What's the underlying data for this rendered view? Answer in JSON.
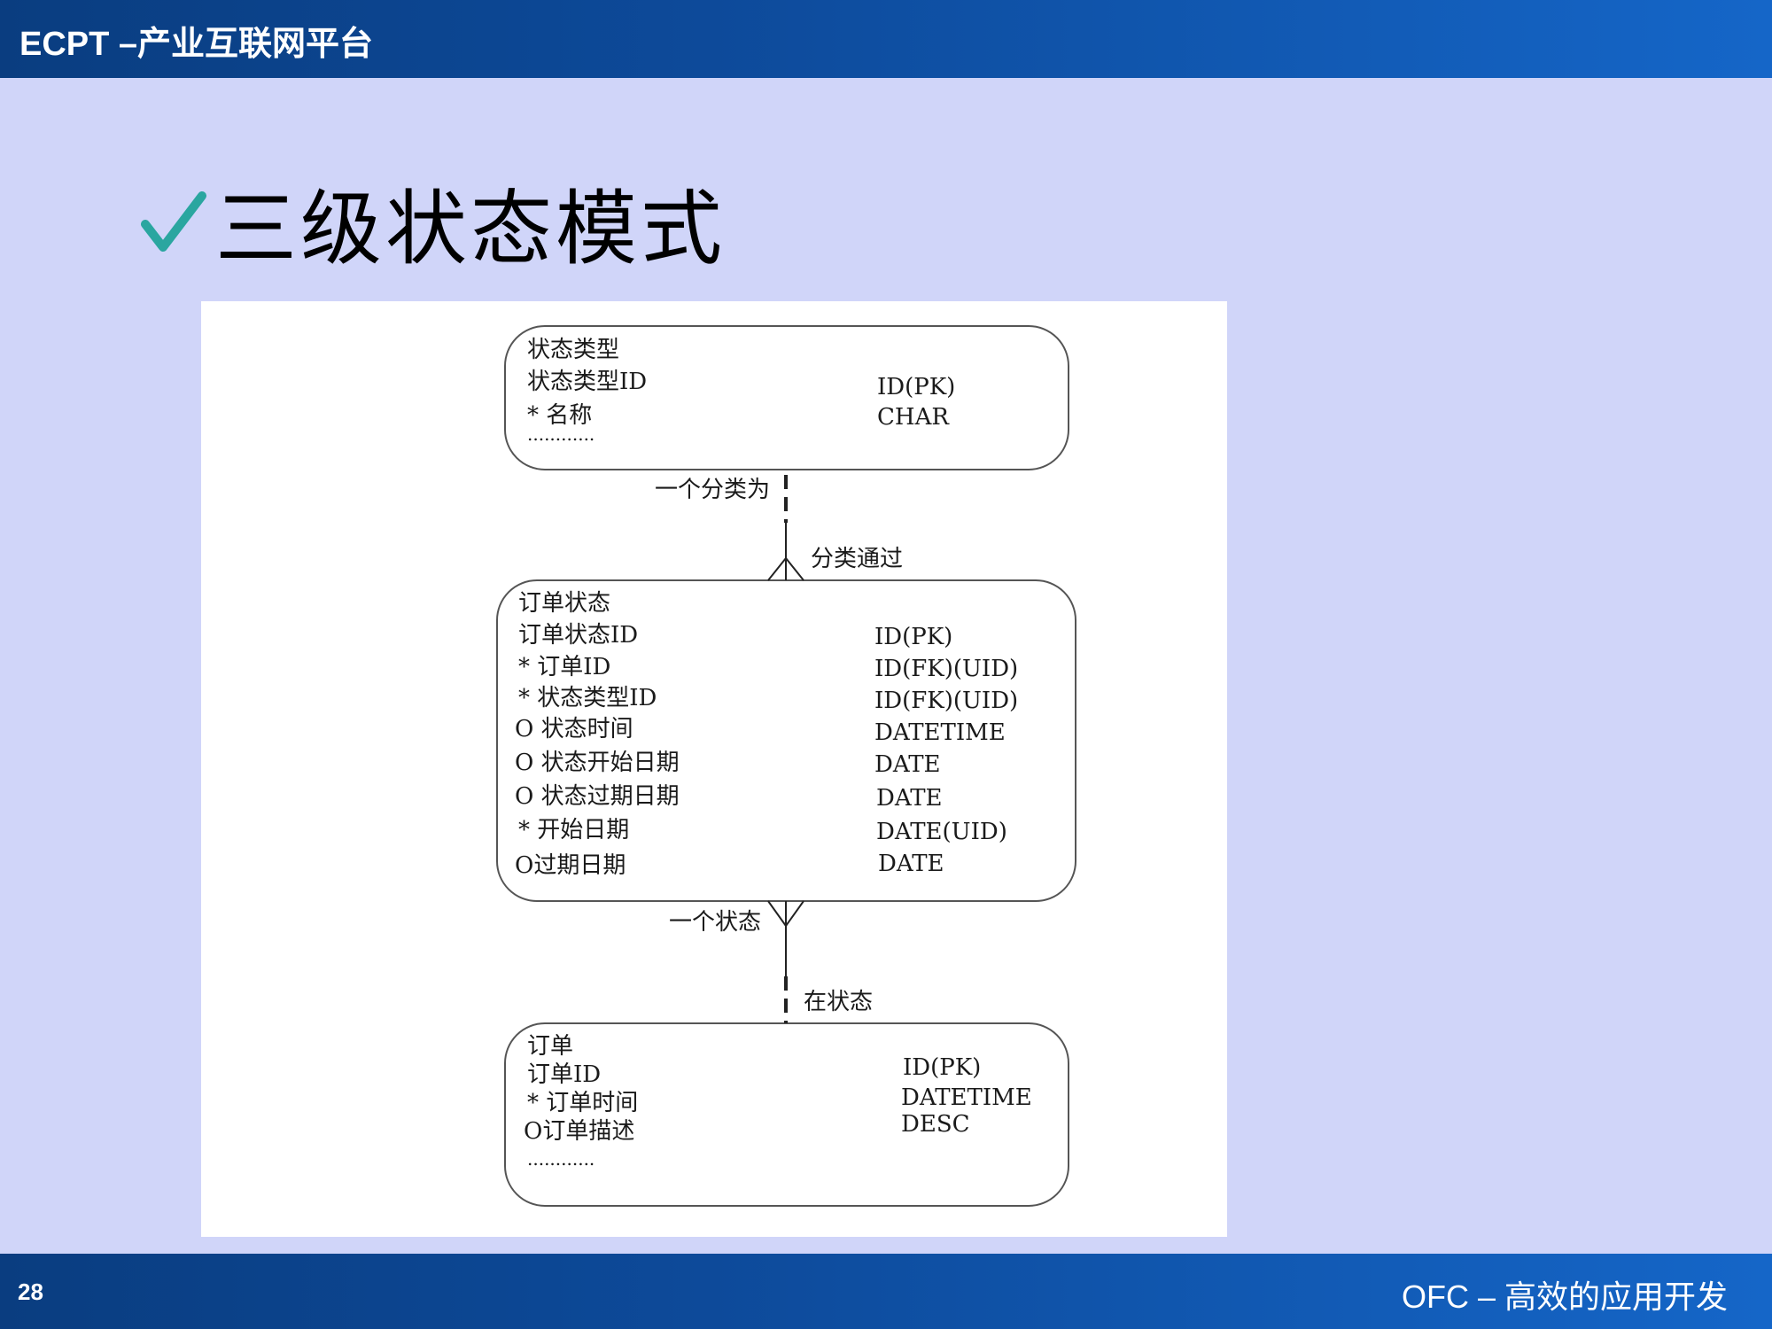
{
  "header": {
    "title": "ECPT –产业互联网平台"
  },
  "heading": {
    "check_icon": "checkmark-icon",
    "check_color": "#2aa6a0",
    "text": "三级状态模式"
  },
  "diagram": {
    "entities": [
      {
        "name": "状态类型",
        "rows": [
          {
            "field": "状态类型ID",
            "type": "ID(PK)"
          },
          {
            "field": "* 名称",
            "type": "CHAR"
          },
          {
            "field": "............",
            "type": ""
          }
        ]
      },
      {
        "name": "订单状态",
        "rows": [
          {
            "field": "订单状态ID",
            "type": "ID(PK)"
          },
          {
            "field": "* 订单ID",
            "type": "ID(FK)(UID)"
          },
          {
            "field": "* 状态类型ID",
            "type": "ID(FK)(UID)"
          },
          {
            "field": "O 状态时间",
            "type": "DATETIME"
          },
          {
            "field": "O 状态开始日期",
            "type": "DATE"
          },
          {
            "field": "O 状态过期日期",
            "type": "DATE"
          },
          {
            "field": "* 开始日期",
            "type": "DATE(UID)"
          },
          {
            "field": "O过期日期",
            "type": "DATE"
          }
        ]
      },
      {
        "name": "订单",
        "rows": [
          {
            "field": "订单ID",
            "type": "ID(PK)"
          },
          {
            "field": "* 订单时间",
            "type": "DATETIME"
          },
          {
            "field": "O订单描述",
            "type": "DESC"
          },
          {
            "field": "............",
            "type": ""
          }
        ]
      }
    ],
    "relationships": [
      {
        "from_label": "一个分类为",
        "to_label": "分类通过"
      },
      {
        "from_label": "一个状态",
        "to_label": "在状态"
      }
    ]
  },
  "footer": {
    "page_number": "28",
    "text": "OFC – 高效的应用开发"
  }
}
